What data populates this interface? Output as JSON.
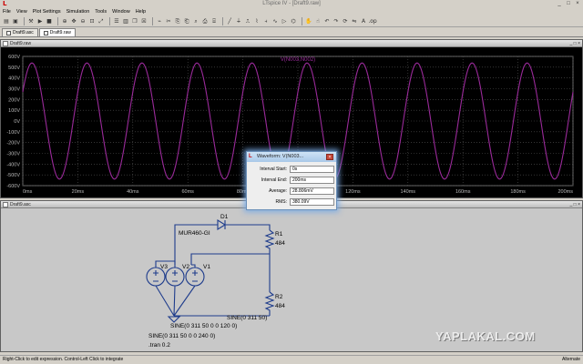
{
  "app": {
    "title": "LTspice IV - [Draft9.raw]"
  },
  "menu": [
    "File",
    "View",
    "Plot Settings",
    "Simulation",
    "Tools",
    "Window",
    "Help"
  ],
  "tabs": [
    {
      "label": "Draft9.asc",
      "active": false
    },
    {
      "label": "Draft9.raw",
      "active": true
    }
  ],
  "plot_window": {
    "title": "Draft9.raw",
    "trace_label": "V(N003,N002)",
    "trace_color": "#9a2a9a"
  },
  "schematic_window": {
    "title": "Draft9.asc",
    "labels": {
      "d1": "D1",
      "diode_model": "MUR460-GI",
      "r1": "R1",
      "r1_value": "484",
      "r2": "R2",
      "r2_value": "484",
      "v1": "V1",
      "v2": "V2",
      "v3": "V3",
      "sine1": "SINE(0 311 50)",
      "sine2": "SINE(0 311 50 0 0 120 0)",
      "sine3": "SINE(0 311 50 0 0 240 0)",
      "tran": ".tran 0.2"
    }
  },
  "dialog": {
    "title": "Waveform: V(N003...",
    "rows": [
      {
        "label": "Interval Start:",
        "value": "0s"
      },
      {
        "label": "Interval End:",
        "value": "200ms"
      },
      {
        "label": "Average:",
        "value": "28.806mV"
      },
      {
        "label": "RMS:",
        "value": "380.09V"
      }
    ]
  },
  "status": {
    "left": "Right-Click to edit expression. Control-Left Click to integrate",
    "right": "Alternate"
  },
  "watermark": "YAPLAKAL.COM",
  "chart_data": {
    "type": "line",
    "title": "V(N003,N002)",
    "xlabel": "",
    "ylabel": "",
    "x_ticks": [
      "0ms",
      "20ms",
      "40ms",
      "60ms",
      "80ms",
      "100ms",
      "120ms",
      "140ms",
      "160ms",
      "180ms",
      "200ms"
    ],
    "y_ticks": [
      "600V",
      "500V",
      "400V",
      "300V",
      "200V",
      "100V",
      "0V",
      "-100V",
      "-200V",
      "-300V",
      "-400V",
      "-500V",
      "-600V"
    ],
    "xlim": [
      0,
      200
    ],
    "ylim": [
      -600,
      600
    ],
    "grid": true,
    "series": [
      {
        "name": "V(N003,N002)",
        "amplitude": 539,
        "frequency_hz": 50,
        "phase_deg": 30,
        "unit": "V"
      }
    ]
  }
}
